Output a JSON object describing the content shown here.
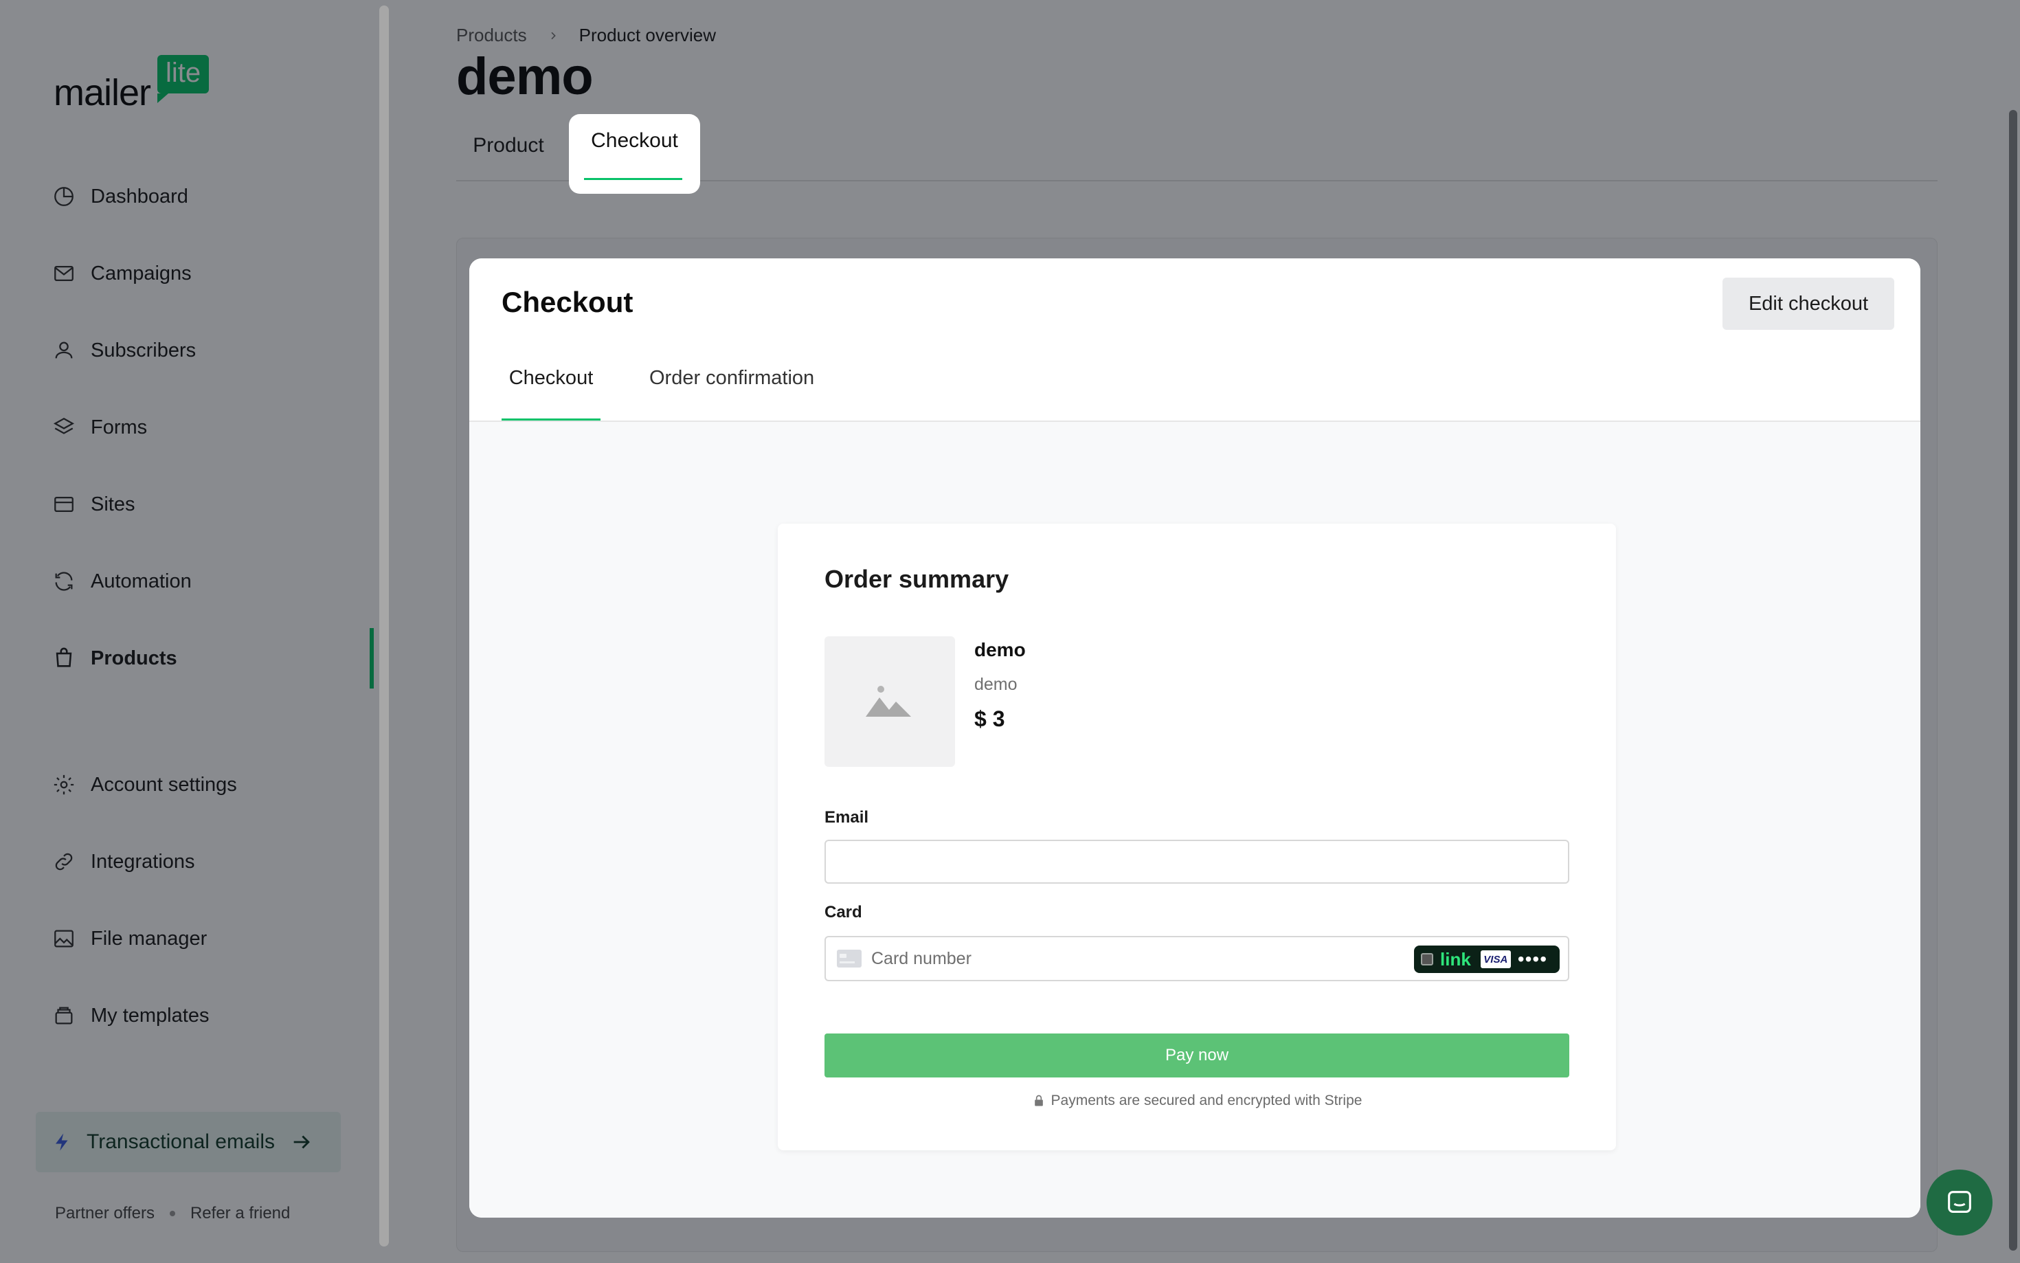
{
  "brand": {
    "word": "mailer",
    "badge": "lite",
    "accent": "#09c269"
  },
  "nav": {
    "items": [
      {
        "label": "Dashboard",
        "icon": "pie-chart-icon"
      },
      {
        "label": "Campaigns",
        "icon": "mail-icon"
      },
      {
        "label": "Subscribers",
        "icon": "user-icon"
      },
      {
        "label": "Forms",
        "icon": "layers-icon"
      },
      {
        "label": "Sites",
        "icon": "browser-icon"
      },
      {
        "label": "Automation",
        "icon": "refresh-icon"
      },
      {
        "label": "Products",
        "icon": "shopping-bag-icon",
        "active": true
      },
      {
        "label": "Account settings",
        "icon": "gear-icon"
      },
      {
        "label": "Integrations",
        "icon": "link-icon"
      },
      {
        "label": "File manager",
        "icon": "image-icon"
      },
      {
        "label": "My templates",
        "icon": "template-icon"
      }
    ],
    "promo": {
      "label": "Transactional emails",
      "icon": "bolt-icon"
    },
    "footer": {
      "partner": "Partner offers",
      "refer": "Refer a friend"
    }
  },
  "breadcrumb": {
    "parent": "Products",
    "current": "Product overview"
  },
  "page": {
    "title": "demo",
    "tabs": [
      {
        "label": "Product"
      },
      {
        "label": "Checkout",
        "active": true
      }
    ]
  },
  "checkout_panel": {
    "title": "Checkout",
    "edit_button": "Edit checkout",
    "tabs": [
      {
        "label": "Checkout",
        "active": true
      },
      {
        "label": "Order confirmation"
      }
    ]
  },
  "order_summary": {
    "title": "Order summary",
    "product": {
      "name": "demo",
      "description": "demo",
      "price": "$ 3"
    },
    "email_label": "Email",
    "email_value": "",
    "card_label": "Card",
    "card_placeholder": "Card number",
    "link_label": "link",
    "visa_label": "VISA",
    "dots": "••••",
    "pay_button": "Pay now",
    "secure_note": "Payments are secured and encrypted with Stripe",
    "pay_color": "#5cc276"
  },
  "overlay": {
    "color": "rgba(8,12,20,0.48)"
  }
}
